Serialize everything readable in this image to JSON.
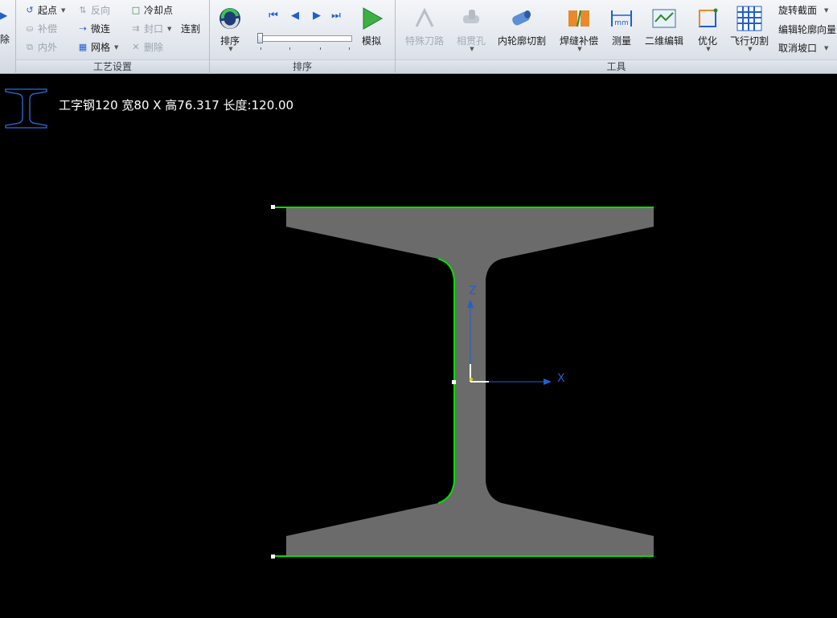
{
  "ribbon": {
    "left_partial_label": "除",
    "process_settings": {
      "label": "工艺设置",
      "col1": [
        "起点",
        "补偿",
        "内外"
      ],
      "col2": [
        "反向",
        "微连",
        "网格"
      ],
      "col3": [
        "冷却点",
        "封口",
        "删除"
      ],
      "lianGe": "连割"
    },
    "sort_group": {
      "label": "排序",
      "sort_button": "排序",
      "simulate_button": "模拟"
    },
    "tools": {
      "label": "工具",
      "buttons": [
        "特殊刀路",
        "相贯孔",
        "内轮廓切割",
        "焊缝补偿",
        "测量",
        "二维编辑",
        "优化",
        "飞行切割"
      ],
      "measure_unit": "mm",
      "side_items": [
        "旋转截面",
        "编辑轮廓向量",
        "取消坡口"
      ]
    }
  },
  "canvas": {
    "profile_title": "工字钢120  宽80 X 高76.317 长度:120.00",
    "axis_x": "X",
    "axis_z": "Z"
  },
  "colors": {
    "accent": "#1f5fd0",
    "profile_fill": "#6b6b6b",
    "outline": "#00e000",
    "axis": "#1f5fd0"
  }
}
